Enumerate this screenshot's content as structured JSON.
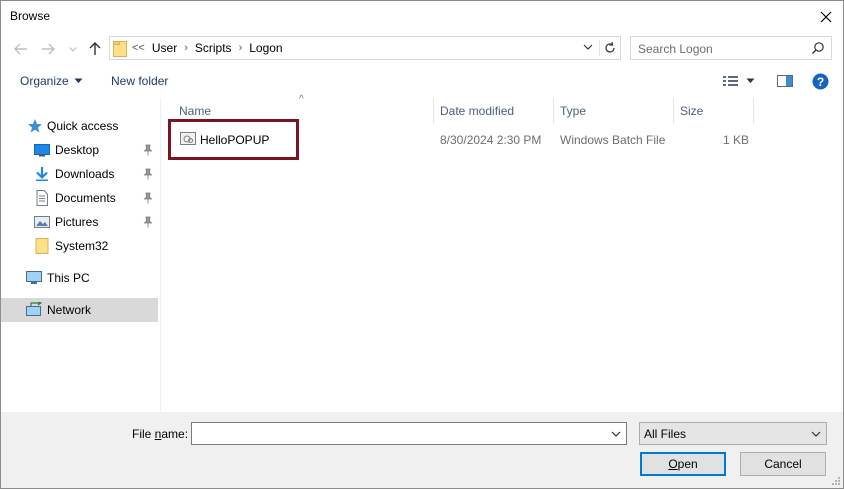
{
  "window": {
    "title": "Browse"
  },
  "nav": {
    "breadcrumb_overflow": "<<",
    "breadcrumb": [
      "User",
      "Scripts",
      "Logon"
    ],
    "search_placeholder": "Search Logon"
  },
  "toolbar": {
    "organize_label": "Organize",
    "new_folder_label": "New folder"
  },
  "sidebar": {
    "items": [
      {
        "label": "Quick access",
        "icon": "star-icon"
      },
      {
        "label": "Desktop",
        "icon": "desktop-icon",
        "pinned": true
      },
      {
        "label": "Downloads",
        "icon": "download-icon",
        "pinned": true
      },
      {
        "label": "Documents",
        "icon": "documents-icon",
        "pinned": true
      },
      {
        "label": "Pictures",
        "icon": "pictures-icon",
        "pinned": true
      },
      {
        "label": "System32",
        "icon": "folder-icon"
      },
      {
        "label": "This PC",
        "icon": "computer-icon"
      },
      {
        "label": "Network",
        "icon": "network-icon",
        "selected": true
      }
    ]
  },
  "columns": {
    "name": "Name",
    "date": "Date modified",
    "type": "Type",
    "size": "Size"
  },
  "files": [
    {
      "name": "HelloPOPUP",
      "date": "8/30/2024 2:30 PM",
      "type": "Windows Batch File",
      "size": "1 KB",
      "highlighted": true
    }
  ],
  "footer": {
    "file_name_label_pre": "File ",
    "file_name_label_accel": "n",
    "file_name_label_post": "ame:",
    "file_name_value": "",
    "filter_value": "All Files",
    "open_accel": "O",
    "open_rest": "pen",
    "cancel_label": "Cancel"
  },
  "colors": {
    "highlight_border": "#7a1420",
    "accent": "#0078d7",
    "selected_bg": "#d9d9d9"
  }
}
